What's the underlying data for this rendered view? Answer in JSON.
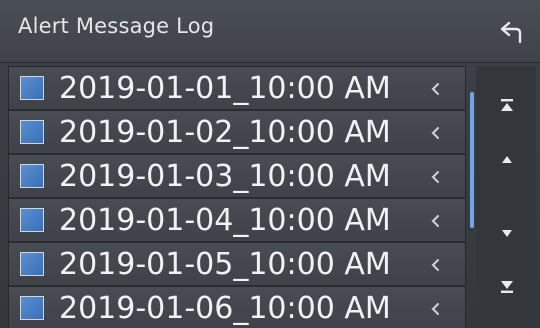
{
  "header": {
    "title": "Alert Message Log",
    "back_icon": "return-arrow-icon"
  },
  "log_items": [
    {
      "label": "2019-01-01_10:00 AM",
      "checked": true
    },
    {
      "label": "2019-01-02_10:00 AM",
      "checked": true
    },
    {
      "label": "2019-01-03_10:00 AM",
      "checked": true
    },
    {
      "label": "2019-01-04_10:00 AM",
      "checked": true
    },
    {
      "label": "2019-01-05_10:00 AM",
      "checked": true
    },
    {
      "label": "2019-01-06_10:00 AM",
      "checked": true
    }
  ],
  "row_arrow_icon": "chevron-left-icon",
  "side_controls": [
    {
      "name": "scroll-top-button",
      "icon": "skip-to-top-icon"
    },
    {
      "name": "scroll-up-button",
      "icon": "triangle-up-icon"
    },
    {
      "name": "scroll-down-button",
      "icon": "triangle-down-icon"
    },
    {
      "name": "scroll-bottom-button",
      "icon": "skip-to-bottom-icon"
    }
  ],
  "colors": {
    "background": "#3a3e44",
    "checkbox_fill": "#4a80c6",
    "scrollbar": "#6fa6e6",
    "text": "#f1f2f4"
  }
}
